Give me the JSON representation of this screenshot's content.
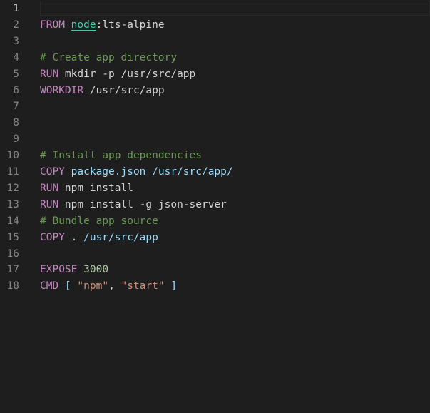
{
  "editor": {
    "lines": [
      {
        "num": "1",
        "tokens": []
      },
      {
        "num": "2",
        "tokens": [
          {
            "t": "FROM",
            "c": "kw"
          },
          {
            "t": " ",
            "c": "txt"
          },
          {
            "t": "node",
            "c": "link"
          },
          {
            "t": ":lts-alpine",
            "c": "txt"
          }
        ]
      },
      {
        "num": "3",
        "tokens": []
      },
      {
        "num": "4",
        "tokens": [
          {
            "t": "# Create app directory",
            "c": "cm"
          }
        ]
      },
      {
        "num": "5",
        "tokens": [
          {
            "t": "RUN",
            "c": "kw"
          },
          {
            "t": " mkdir -p /usr/src/app",
            "c": "txt"
          }
        ]
      },
      {
        "num": "6",
        "tokens": [
          {
            "t": "WORKDIR",
            "c": "kw"
          },
          {
            "t": " /usr/src/app",
            "c": "txt"
          }
        ]
      },
      {
        "num": "7",
        "tokens": []
      },
      {
        "num": "8",
        "tokens": []
      },
      {
        "num": "9",
        "tokens": []
      },
      {
        "num": "10",
        "tokens": [
          {
            "t": "# Install app dependencies",
            "c": "cm"
          }
        ]
      },
      {
        "num": "11",
        "tokens": [
          {
            "t": "COPY",
            "c": "kw"
          },
          {
            "t": " package.json /usr/src/app/",
            "c": "arg"
          }
        ]
      },
      {
        "num": "12",
        "tokens": [
          {
            "t": "RUN",
            "c": "kw"
          },
          {
            "t": " npm install",
            "c": "txt"
          }
        ]
      },
      {
        "num": "13",
        "tokens": [
          {
            "t": "RUN",
            "c": "kw"
          },
          {
            "t": " npm install -g json-server",
            "c": "txt"
          }
        ]
      },
      {
        "num": "14",
        "tokens": [
          {
            "t": "# Bundle app source",
            "c": "cm"
          }
        ]
      },
      {
        "num": "15",
        "tokens": [
          {
            "t": "COPY",
            "c": "kw"
          },
          {
            "t": " . /usr/src/app",
            "c": "arg"
          }
        ]
      },
      {
        "num": "16",
        "tokens": []
      },
      {
        "num": "17",
        "tokens": [
          {
            "t": "EXPOSE",
            "c": "kw"
          },
          {
            "t": " ",
            "c": "txt"
          },
          {
            "t": "3000",
            "c": "num"
          }
        ]
      },
      {
        "num": "18",
        "tokens": [
          {
            "t": "CMD",
            "c": "kw"
          },
          {
            "t": " [ ",
            "c": "arg"
          },
          {
            "t": "\"npm\"",
            "c": "str"
          },
          {
            "t": ", ",
            "c": "txt"
          },
          {
            "t": "\"start\"",
            "c": "str"
          },
          {
            "t": " ]",
            "c": "arg"
          }
        ]
      }
    ],
    "active_line": "1"
  }
}
